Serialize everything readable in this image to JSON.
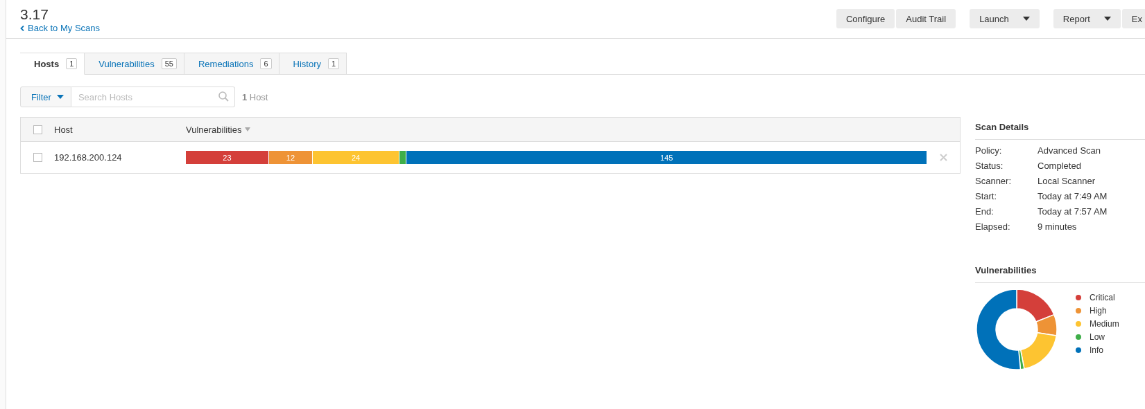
{
  "header": {
    "title": "3.17",
    "back_link": "Back to My Scans",
    "button_groups": [
      [
        {
          "label": "Configure",
          "has_menu": false
        },
        {
          "label": "Audit Trail",
          "has_menu": false
        }
      ],
      [
        {
          "label": "Launch",
          "has_menu": true
        }
      ],
      [
        {
          "label": "Report",
          "has_menu": true
        },
        {
          "label": "Ex",
          "has_menu": false
        }
      ]
    ]
  },
  "tabs": [
    {
      "label": "Hosts",
      "count": "1",
      "selected": true
    },
    {
      "label": "Vulnerabilities",
      "count": "55",
      "selected": false
    },
    {
      "label": "Remediations",
      "count": "6",
      "selected": false
    },
    {
      "label": "History",
      "count": "1",
      "selected": false
    }
  ],
  "filter": {
    "button": "Filter",
    "placeholder": "Search Hosts",
    "count": "1",
    "count_label": "Host"
  },
  "table": {
    "columns": [
      {
        "label": "Host",
        "sorted": false
      },
      {
        "label": "Vulnerabilities",
        "sorted": true
      }
    ],
    "rows": [
      {
        "host": "192.168.200.124",
        "checked": false,
        "segments": [
          {
            "label": "23",
            "color": "#d43f3a"
          },
          {
            "label": "12",
            "color": "#ee9336"
          },
          {
            "label": "24",
            "color": "#fdc431"
          },
          {
            "color": "#3fae49"
          },
          {
            "label": "145",
            "color": "#0071b9"
          }
        ]
      }
    ],
    "all_checked": false
  },
  "scan_details": {
    "title": "Scan Details",
    "rows": [
      {
        "label": "Policy:",
        "value": "Advanced Scan"
      },
      {
        "label": "Status:",
        "value": "Completed"
      },
      {
        "label": "Scanner:",
        "value": "Local Scanner"
      },
      {
        "label": "Start:",
        "value": "Today at 7:49 AM"
      },
      {
        "label": "End:",
        "value": "Today at 7:57 AM"
      },
      {
        "label": "Elapsed:",
        "value": "9 minutes"
      }
    ]
  },
  "vulnerabilities_panel": {
    "title": "Vulnerabilities",
    "legend": [
      {
        "label": "Critical",
        "color": "#d43f3a"
      },
      {
        "label": "High",
        "color": "#ee9336"
      },
      {
        "label": "Medium",
        "color": "#fdc431"
      },
      {
        "label": "Low",
        "color": "#3fae49"
      },
      {
        "label": "Info",
        "color": "#0071b9"
      }
    ]
  }
}
